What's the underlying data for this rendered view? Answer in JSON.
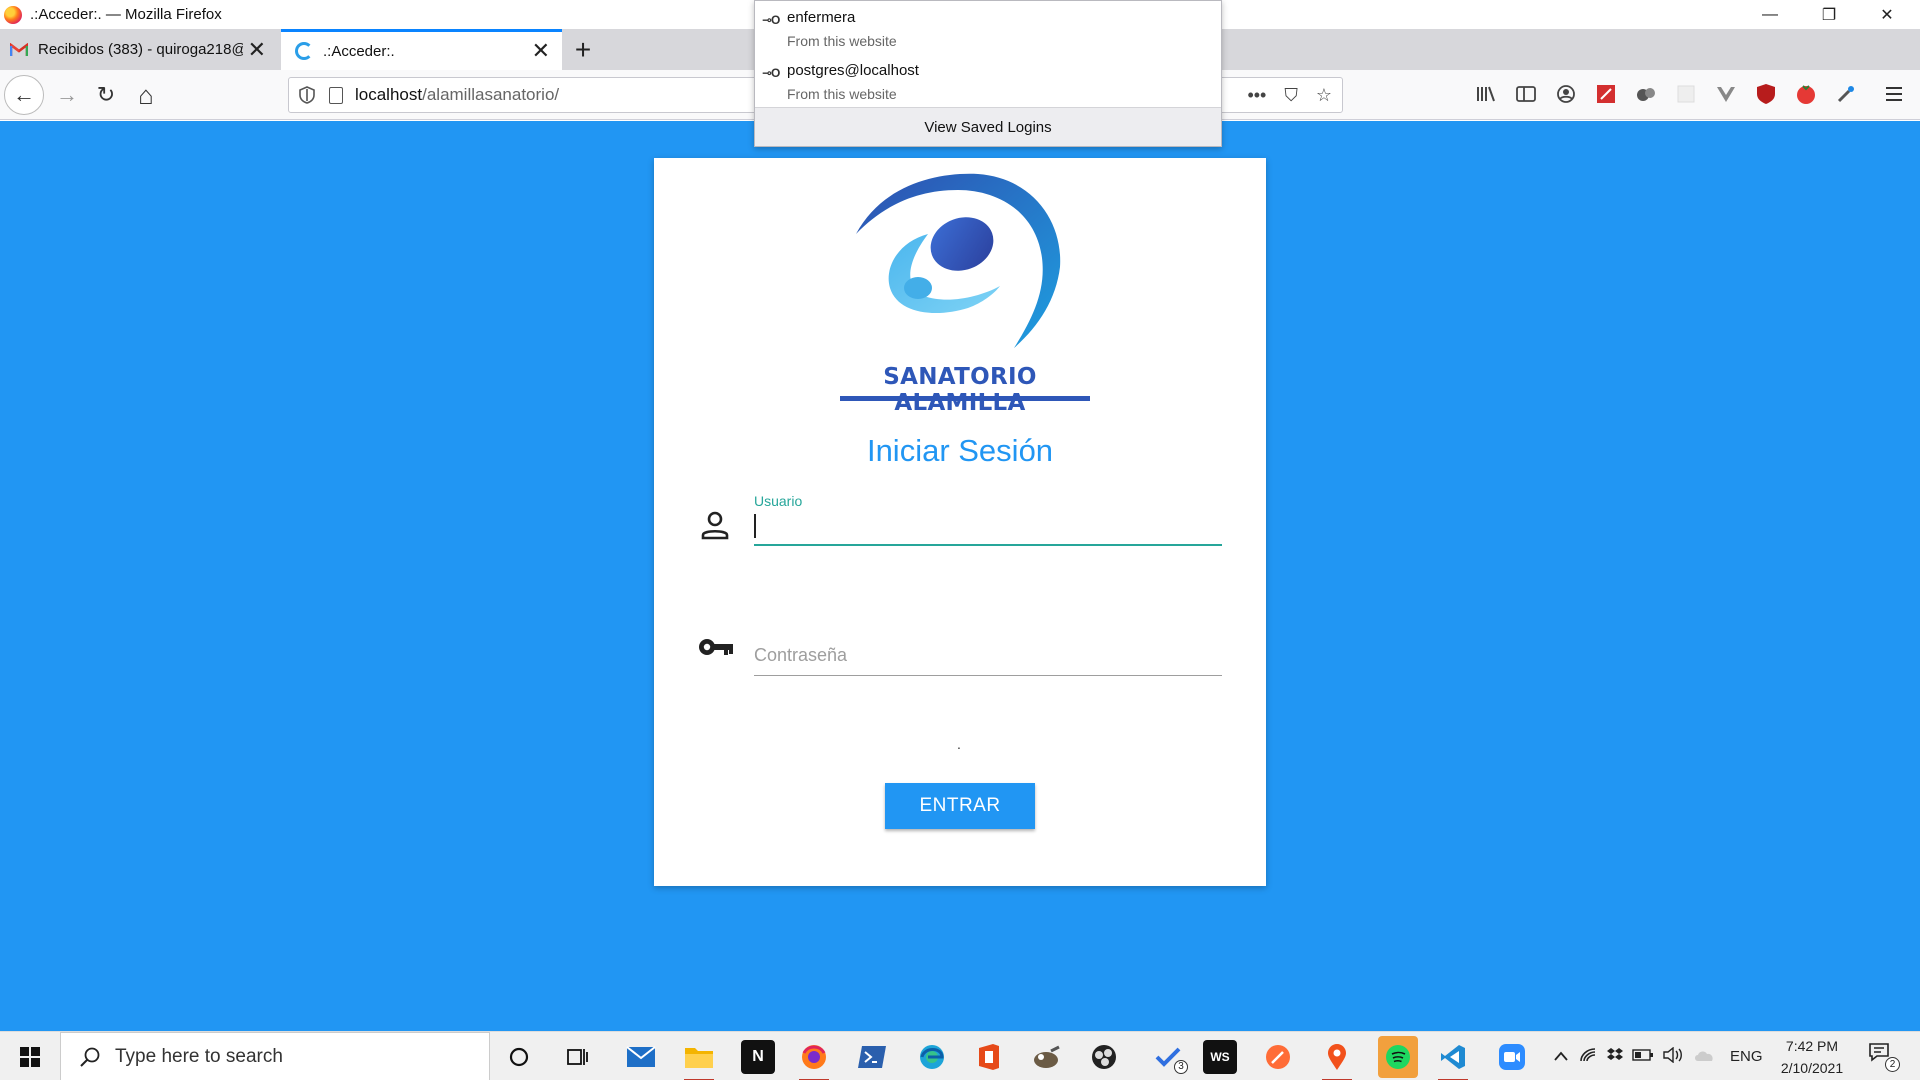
{
  "window": {
    "title": ".:Acceder:. — Mozilla Firefox",
    "minimize": "—",
    "maximize": "❐",
    "close": "✕"
  },
  "tabs": [
    {
      "title": "Recibidos (383) - quiroga218@",
      "icon": "gmail-icon",
      "active": false
    },
    {
      "title": ".:Acceder:.",
      "icon": "globe-icon",
      "active": true
    }
  ],
  "tab_close": "✕",
  "new_tab": "+",
  "nav": {
    "back": "←",
    "forward": "→",
    "reload": "↻",
    "home": "⌂",
    "url_host": "localhost",
    "url_path": "/alamillasanatorio/",
    "page_actions": "•••",
    "pocket": "⛉",
    "bookmark": "☆"
  },
  "saved_logins": {
    "items": [
      {
        "username": "enfermera",
        "source": "From this website"
      },
      {
        "username": "postgres@localhost",
        "source": "From this website"
      }
    ],
    "key_glyph": "⊸O",
    "footer": "View Saved Logins"
  },
  "login_page": {
    "brand": "SANATORIO ALAMILLA",
    "title": "Iniciar Sesión",
    "username_label": "Usuario",
    "username_value": "",
    "password_placeholder": "Contraseña",
    "status_text": ".",
    "submit_label": "ENTRAR",
    "colors": {
      "background": "#2196f3",
      "accent": "#26a69a",
      "brand": "#2e57b8"
    }
  },
  "taskbar": {
    "search_placeholder": "Type here to search",
    "language": "ENG",
    "time": "7:42 PM",
    "date": "2/10/2021",
    "notification_count": "2",
    "badge_count": "3"
  }
}
